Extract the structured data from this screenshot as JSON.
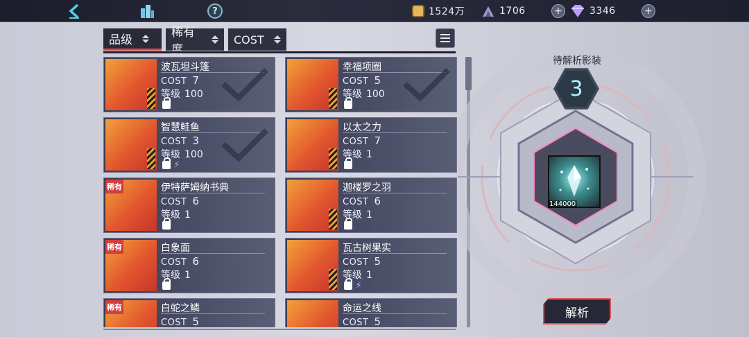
{
  "top_bar": {
    "gold": "1524万",
    "ore": "1706",
    "gems": "3346",
    "back_icon": "back-arrow-icon",
    "city_icon": "city-icon",
    "help_icon": "help-icon",
    "help_symbol": "?"
  },
  "filters": {
    "grade_label": "品级",
    "rarity_label": "稀有度",
    "cost_label": "COST"
  },
  "labels": {
    "cost": "COST",
    "level": "等级",
    "rare_badge": "稀有"
  },
  "items": [
    {
      "name": "波瓦坦斗篷",
      "cost": "7",
      "level": "100",
      "checked": true,
      "rare": false,
      "bolt": false
    },
    {
      "name": "幸福项圈",
      "cost": "5",
      "level": "100",
      "checked": true,
      "rare": false,
      "bolt": false
    },
    {
      "name": "智慧鲑鱼",
      "cost": "3",
      "level": "100",
      "checked": true,
      "rare": false,
      "bolt": true
    },
    {
      "name": "以太之力",
      "cost": "7",
      "level": "1",
      "checked": false,
      "rare": false,
      "bolt": false
    },
    {
      "name": "伊特萨姆纳书典",
      "cost": "6",
      "level": "1",
      "checked": false,
      "rare": true,
      "bolt": false
    },
    {
      "name": "迦楼罗之羽",
      "cost": "6",
      "level": "1",
      "checked": false,
      "rare": false,
      "bolt": false
    },
    {
      "name": "白象面",
      "cost": "6",
      "level": "1",
      "checked": false,
      "rare": true,
      "bolt": false
    },
    {
      "name": "瓦古树果实",
      "cost": "5",
      "level": "1",
      "checked": false,
      "rare": false,
      "bolt": true
    },
    {
      "name": "白蛇之鳞",
      "cost": "5",
      "level": "",
      "checked": false,
      "rare": true,
      "bolt": false
    },
    {
      "name": "命运之线",
      "cost": "5",
      "level": "",
      "checked": false,
      "rare": false,
      "bolt": false
    }
  ],
  "right_panel": {
    "title": "待解析影装",
    "pending_count": "3",
    "slot_value": "144000",
    "analyze_label": "解析"
  },
  "colors": {
    "accent_red": "#d84a4a",
    "teal": "#aef3ff",
    "card_bg": "#4c5068"
  }
}
